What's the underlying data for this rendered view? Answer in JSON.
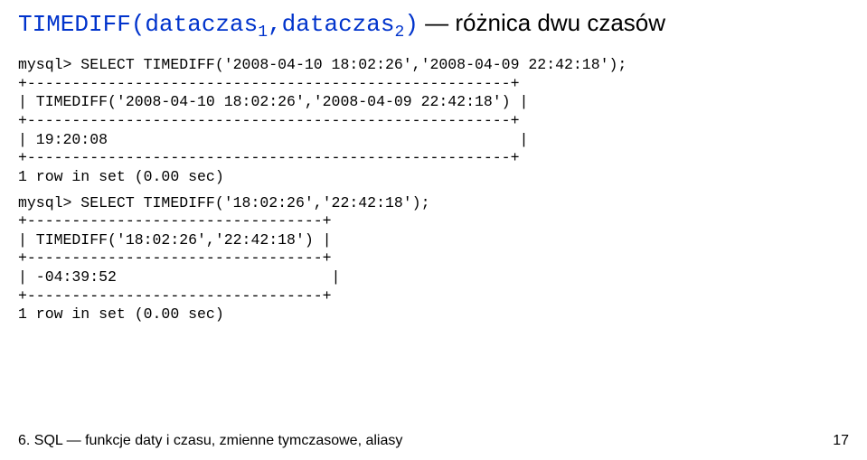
{
  "heading": {
    "func_prefix": "TIMEDIFF(dataczas",
    "sub1": "1",
    "func_mid": ",dataczas",
    "sub2": "2",
    "func_suffix": ")",
    "description": " — różnica dwu czasów"
  },
  "block1": {
    "line1": "mysql> SELECT TIMEDIFF('2008-04-10 18:02:26','2008-04-09 22:42:18');",
    "sep1": "+------------------------------------------------------+",
    "header": "| TIMEDIFF('2008-04-10 18:02:26','2008-04-09 22:42:18') |",
    "sep2": "+------------------------------------------------------+",
    "value": "| 19:20:08                                              |",
    "sep3": "+------------------------------------------------------+",
    "result": "1 row in set (0.00 sec)"
  },
  "block2": {
    "line1": "mysql> SELECT TIMEDIFF('18:02:26','22:42:18');",
    "sep1": "+---------------------------------+",
    "header": "| TIMEDIFF('18:02:26','22:42:18') |",
    "sep2": "+---------------------------------+",
    "value": "| -04:39:52                        |",
    "sep3": "+---------------------------------+",
    "result": "1 row in set (0.00 sec)"
  },
  "footer": {
    "text": "6. SQL — funkcje daty i czasu, zmienne tymczasowe, aliasy",
    "page": "17"
  }
}
